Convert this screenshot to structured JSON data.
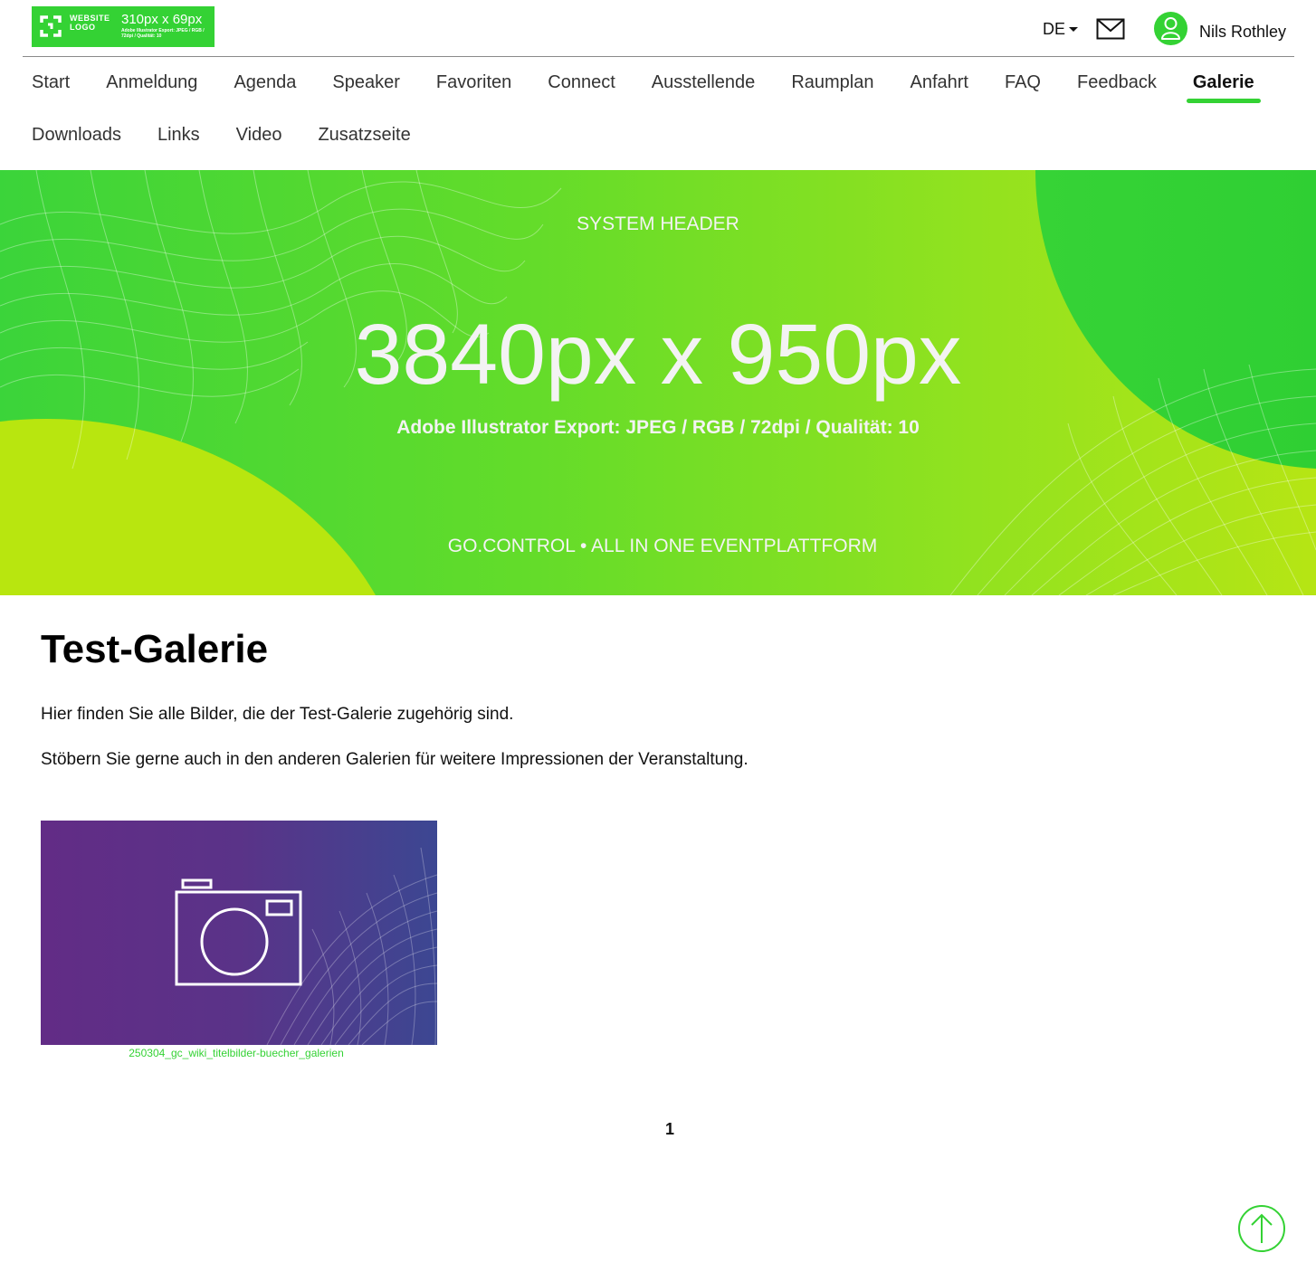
{
  "header": {
    "logo": {
      "word": "WEBSITE LOGO",
      "size": "310px x 69px",
      "spec": "Adobe Illustrator Export: JPEG / RGB / 72dpi / Qualität: 10"
    },
    "language": "DE",
    "user_name": "Nils Rothley"
  },
  "nav": {
    "items": [
      {
        "label": "Start",
        "active": false
      },
      {
        "label": "Anmeldung",
        "active": false
      },
      {
        "label": "Agenda",
        "active": false
      },
      {
        "label": "Speaker",
        "active": false
      },
      {
        "label": "Favoriten",
        "active": false
      },
      {
        "label": "Connect",
        "active": false
      },
      {
        "label": "Ausstellende",
        "active": false
      },
      {
        "label": "Raumplan",
        "active": false
      },
      {
        "label": "Anfahrt",
        "active": false
      },
      {
        "label": "FAQ",
        "active": false
      },
      {
        "label": "Feedback",
        "active": false
      },
      {
        "label": "Galerie",
        "active": true
      },
      {
        "label": "Downloads",
        "active": false
      },
      {
        "label": "Links",
        "active": false
      },
      {
        "label": "Video",
        "active": false
      },
      {
        "label": "Zusatzseite",
        "active": false
      }
    ]
  },
  "hero": {
    "label": "SYSTEM HEADER",
    "dimensions": "3840px x 950px",
    "export_spec": "Adobe Illustrator Export: JPEG / RGB / 72dpi / Qualität: 10",
    "footer": "GO.CONTROL • ALL IN ONE EVENTPLATTFORM"
  },
  "main": {
    "title": "Test-Galerie",
    "paragraphs": [
      "Hier finden Sie alle Bilder, die der Test-Galerie zugehörig sind.",
      "Stöbern Sie gerne auch in den anderen Galerien für weitere Impressionen der Veranstaltung."
    ],
    "gallery": [
      {
        "caption": "250304_gc_wiki_titelbilder-buecher_galerien",
        "icon": "camera-icon"
      }
    ],
    "pagination": {
      "current_page": "1"
    }
  },
  "colors": {
    "accent": "#34d234",
    "hero_gradient_start": "#3bd43a",
    "hero_gradient_end": "#b6e514",
    "thumb_gradient_start": "#622c86",
    "thumb_gradient_end": "#3c4792"
  }
}
